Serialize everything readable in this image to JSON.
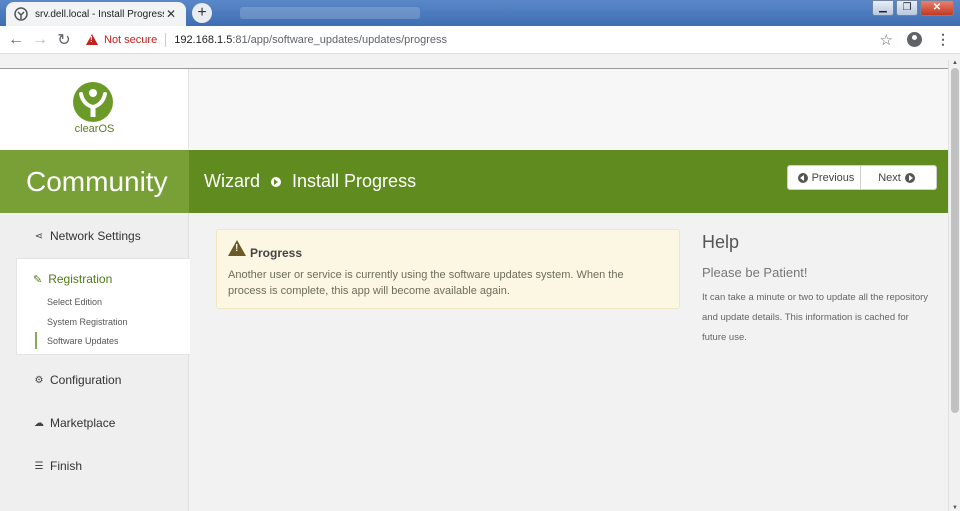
{
  "browser": {
    "tab_title": "srv.dell.local - Install Progress",
    "tab_close": "✕",
    "new_tab": "+",
    "security_label": "Not secure",
    "url_host": "192.168.1.5",
    "url_path": ":81/app/software_updates/updates/progress"
  },
  "logo": {
    "text": "clearOS"
  },
  "header": {
    "edition": "Community",
    "breadcrumb_root": "Wizard",
    "breadcrumb_current": "Install Progress",
    "previous_label": "Previous",
    "next_label": "Next",
    "brand_color": "#5f8b1f"
  },
  "sidebar": {
    "network": "Network Settings",
    "registration": "Registration",
    "sub_items": [
      "Select Edition",
      "System Registration",
      "Software Updates"
    ],
    "configuration": "Configuration",
    "marketplace": "Marketplace",
    "finish": "Finish"
  },
  "alert": {
    "title": "Progress",
    "body": "Another user or service is currently using the software updates system. When the process is complete, this app will become available again."
  },
  "help": {
    "title": "Help",
    "subtitle": "Please be Patient!",
    "text": "It can take a minute or two to update all the repository and update details. This information is cached for future use."
  }
}
